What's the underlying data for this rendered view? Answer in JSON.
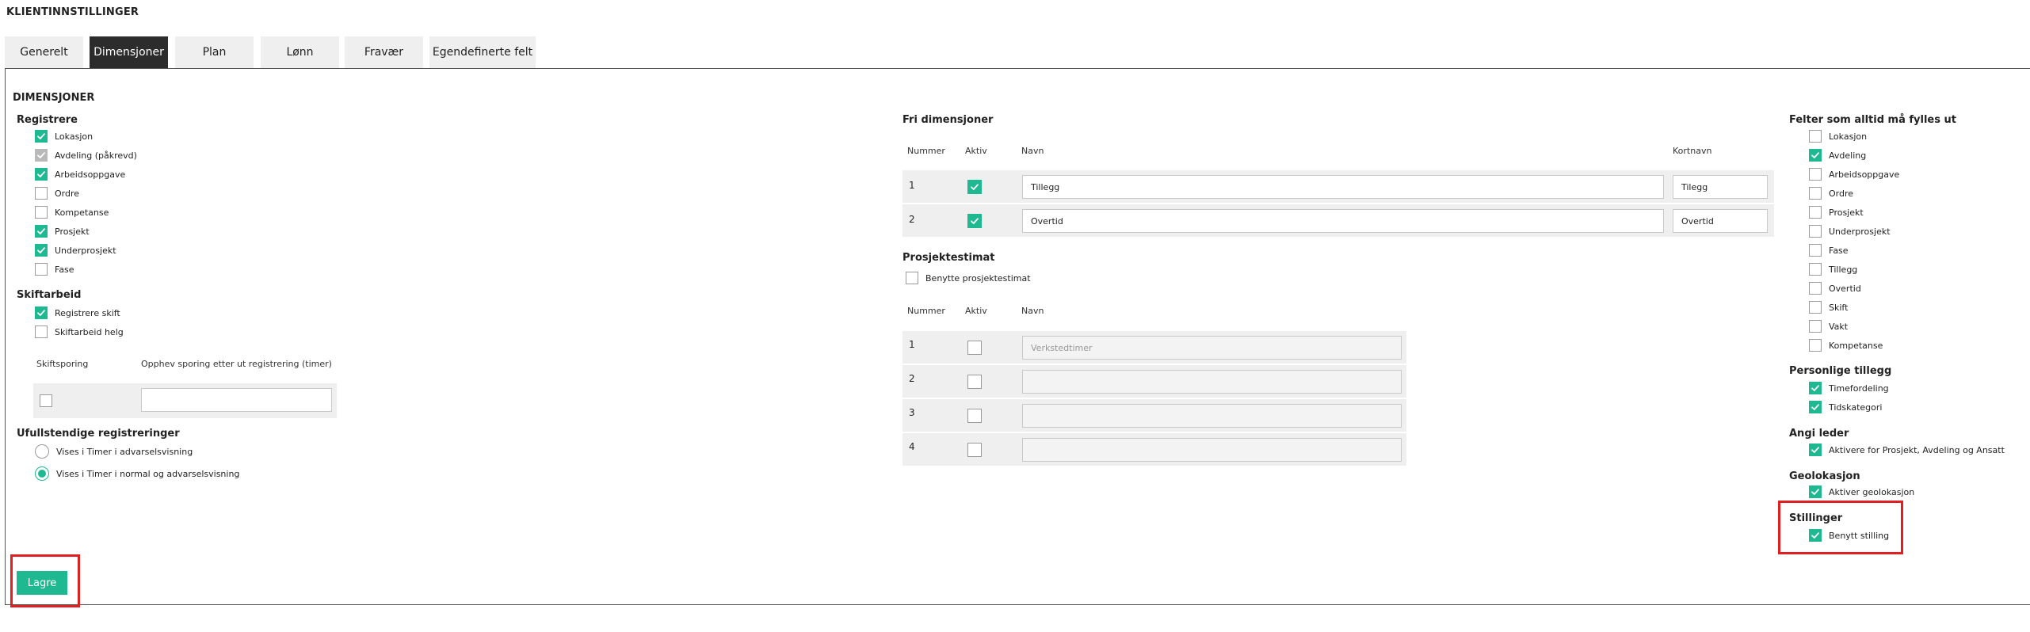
{
  "page_title": "KLIENTINNSTILLINGER",
  "tabs": [
    {
      "label": "Generelt",
      "active": false
    },
    {
      "label": "Dimensjoner",
      "active": true
    },
    {
      "label": "Plan",
      "active": false
    },
    {
      "label": "Lønn",
      "active": false
    },
    {
      "label": "Fravær",
      "active": false
    },
    {
      "label": "Egendefinerte felt",
      "active": false
    }
  ],
  "section_title": "DIMENSJONER",
  "registrere": {
    "title": "Registrere",
    "items": [
      {
        "label": "Lokasjon",
        "checked": true
      },
      {
        "label": "Avdeling (påkrevd)",
        "checked": true,
        "disabled": true
      },
      {
        "label": "Arbeidsoppgave",
        "checked": true
      },
      {
        "label": "Ordre",
        "checked": false
      },
      {
        "label": "Kompetanse",
        "checked": false
      },
      {
        "label": "Prosjekt",
        "checked": true
      },
      {
        "label": "Underprosjekt",
        "checked": true
      },
      {
        "label": "Fase",
        "checked": false
      }
    ]
  },
  "skiftarbeid": {
    "title": "Skiftarbeid",
    "items": [
      {
        "label": "Registrere skift",
        "checked": true
      },
      {
        "label": "Skiftarbeid helg",
        "checked": false
      }
    ],
    "col_skiftsporing": "Skiftsporing",
    "col_opphev": "Opphev sporing etter ut registrering (timer)",
    "skiftsporing_checked": false,
    "opphev_value": ""
  },
  "ufullstendige": {
    "title": "Ufullstendige registreringer",
    "options": [
      {
        "label": "Vises i Timer i advarselsvisning",
        "selected": false
      },
      {
        "label": "Vises i Timer i normal og advarselsvisning",
        "selected": true
      }
    ]
  },
  "fri_dimensjoner": {
    "title": "Fri dimensjoner",
    "headers": {
      "nummer": "Nummer",
      "aktiv": "Aktiv",
      "navn": "Navn",
      "kortnavn": "Kortnavn"
    },
    "rows": [
      {
        "nummer": "1",
        "aktiv": true,
        "navn": "Tillegg",
        "kortnavn": "Tilegg"
      },
      {
        "nummer": "2",
        "aktiv": true,
        "navn": "Overtid",
        "kortnavn": "Overtid"
      }
    ]
  },
  "prosjektestimat": {
    "title": "Prosjektestimat",
    "use_label": "Benytte prosjektestimat",
    "use_checked": false,
    "headers": {
      "nummer": "Nummer",
      "aktiv": "Aktiv",
      "navn": "Navn"
    },
    "rows": [
      {
        "nummer": "1",
        "aktiv": false,
        "navn": "",
        "placeholder": "Verkstedtimer"
      },
      {
        "nummer": "2",
        "aktiv": false,
        "navn": "",
        "placeholder": ""
      },
      {
        "nummer": "3",
        "aktiv": false,
        "navn": "",
        "placeholder": ""
      },
      {
        "nummer": "4",
        "aktiv": false,
        "navn": "",
        "placeholder": ""
      }
    ]
  },
  "felter": {
    "title": "Felter som alltid må fylles ut",
    "items": [
      {
        "label": "Lokasjon",
        "checked": false
      },
      {
        "label": "Avdeling",
        "checked": true
      },
      {
        "label": "Arbeidsoppgave",
        "checked": false
      },
      {
        "label": "Ordre",
        "checked": false
      },
      {
        "label": "Prosjekt",
        "checked": false
      },
      {
        "label": "Underprosjekt",
        "checked": false
      },
      {
        "label": "Fase",
        "checked": false
      },
      {
        "label": "Tillegg",
        "checked": false
      },
      {
        "label": "Overtid",
        "checked": false
      },
      {
        "label": "Skift",
        "checked": false
      },
      {
        "label": "Vakt",
        "checked": false
      },
      {
        "label": "Kompetanse",
        "checked": false
      }
    ]
  },
  "personlige_tillegg": {
    "title": "Personlige tillegg",
    "items": [
      {
        "label": "Timefordeling",
        "checked": true
      },
      {
        "label": "Tidskategori",
        "checked": true
      }
    ]
  },
  "angi_leder": {
    "title": "Angi leder",
    "items": [
      {
        "label": "Aktivere for Prosjekt, Avdeling og Ansatt",
        "checked": true
      }
    ]
  },
  "geolokasjon": {
    "title": "Geolokasjon",
    "items": [
      {
        "label": "Aktiver geolokasjon",
        "checked": true
      }
    ]
  },
  "stillinger": {
    "title": "Stillinger",
    "items": [
      {
        "label": "Benytt stilling",
        "checked": true
      }
    ]
  },
  "save_label": "Lagre",
  "colors": {
    "accent": "#1eb990",
    "highlight": "#e02020",
    "tab_active": "#2c2c2c"
  }
}
